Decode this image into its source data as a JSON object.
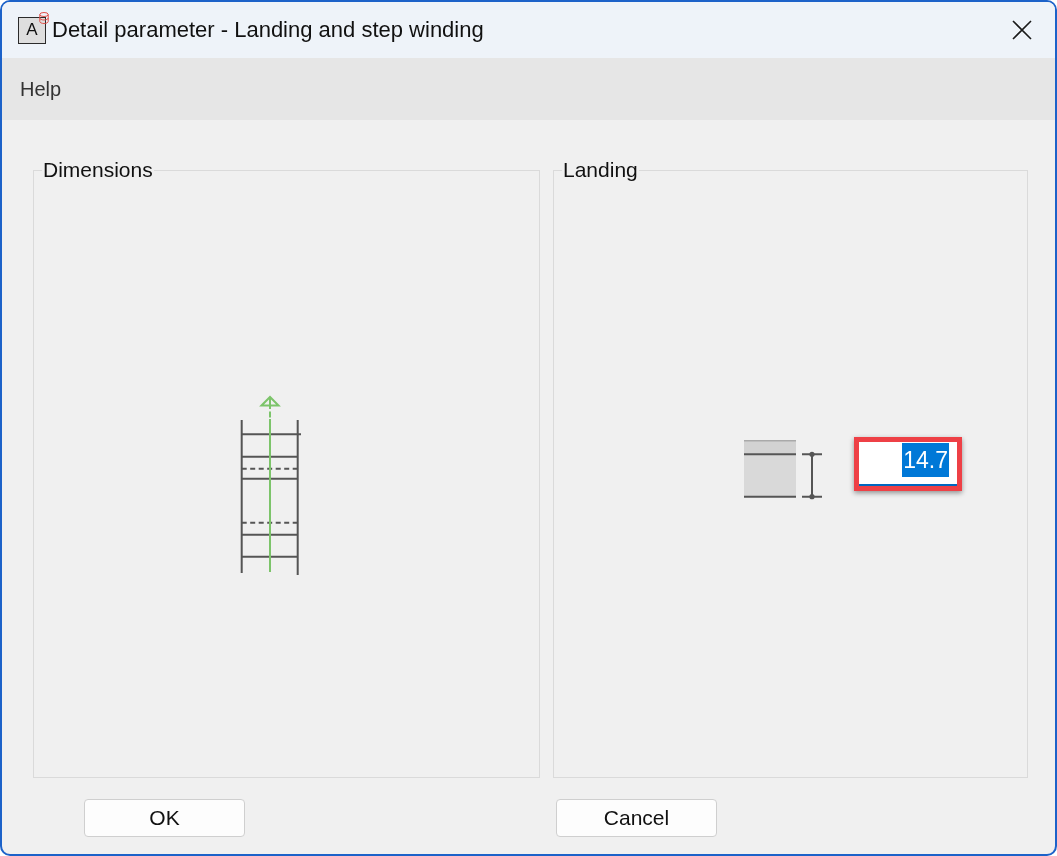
{
  "window": {
    "title": "Detail parameter - Landing and step winding",
    "icon_letter": "A"
  },
  "menu": [
    {
      "label": "Help"
    }
  ],
  "dimensions_group": {
    "title": "Dimensions"
  },
  "landing_group": {
    "title": "Landing",
    "value_field": {
      "value": "14.7",
      "text_selected": true,
      "highlighted": true
    }
  },
  "buttons": [
    {
      "label": "OK"
    },
    {
      "label": "Cancel"
    }
  ]
}
